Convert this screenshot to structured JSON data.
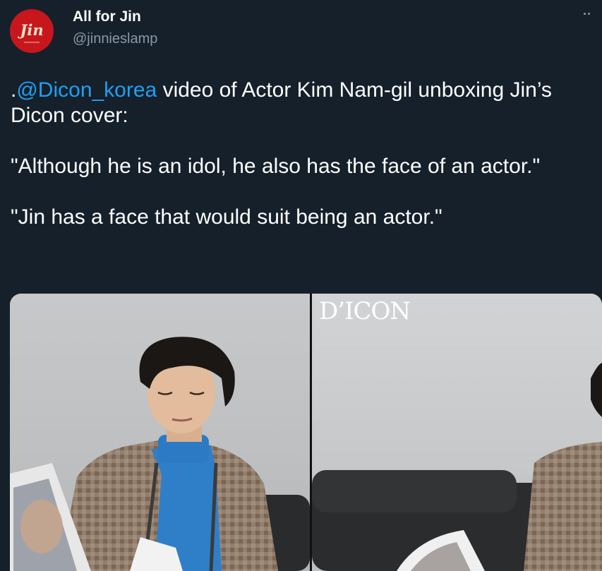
{
  "account": {
    "display_name": "All for Jin",
    "handle": "@jinnieslamp",
    "avatar_text": "Jin"
  },
  "tweet": {
    "line1_prefix": ".",
    "mention": "@Dicon_korea",
    "line1_rest": " video of Actor Kim Nam-gil unboxing Jin’s Dicon cover:",
    "quote1": "\"Although he is an idol, he also has the face of an actor.\"",
    "quote2": "\"Jin has a face that would suit being an actor.\""
  },
  "media": {
    "watermark": "D’ICON"
  },
  "colors": {
    "background": "#15202b",
    "text": "#ffffff",
    "secondary": "#8899a6",
    "mention": "#1da1f2",
    "avatar": "#c8161d"
  }
}
